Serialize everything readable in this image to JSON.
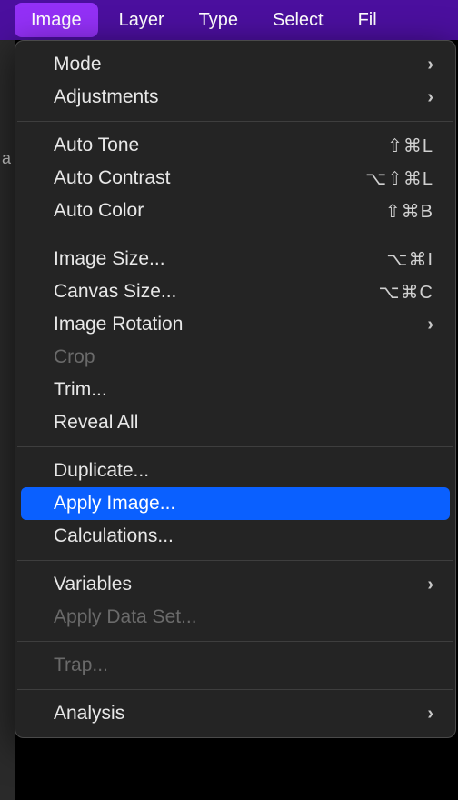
{
  "menubar": {
    "items": [
      {
        "label": "Image",
        "active": true
      },
      {
        "label": "Layer",
        "active": false
      },
      {
        "label": "Type",
        "active": false
      },
      {
        "label": "Select",
        "active": false
      },
      {
        "label": "Fil",
        "active": false
      }
    ]
  },
  "leftStripLetter": "a",
  "dropdown": {
    "groups": [
      [
        {
          "label": "Mode",
          "submenu": true
        },
        {
          "label": "Adjustments",
          "submenu": true
        }
      ],
      [
        {
          "label": "Auto Tone",
          "shortcut": "⇧⌘L"
        },
        {
          "label": "Auto Contrast",
          "shortcut": "⌥⇧⌘L"
        },
        {
          "label": "Auto Color",
          "shortcut": "⇧⌘B"
        }
      ],
      [
        {
          "label": "Image Size...",
          "shortcut": "⌥⌘I"
        },
        {
          "label": "Canvas Size...",
          "shortcut": "⌥⌘C"
        },
        {
          "label": "Image Rotation",
          "submenu": true
        },
        {
          "label": "Crop",
          "disabled": true
        },
        {
          "label": "Trim..."
        },
        {
          "label": "Reveal All"
        }
      ],
      [
        {
          "label": "Duplicate..."
        },
        {
          "label": "Apply Image...",
          "highlight": true
        },
        {
          "label": "Calculations..."
        }
      ],
      [
        {
          "label": "Variables",
          "submenu": true
        },
        {
          "label": "Apply Data Set...",
          "disabled": true
        }
      ],
      [
        {
          "label": "Trap...",
          "disabled": true
        }
      ],
      [
        {
          "label": "Analysis",
          "submenu": true
        }
      ]
    ]
  }
}
